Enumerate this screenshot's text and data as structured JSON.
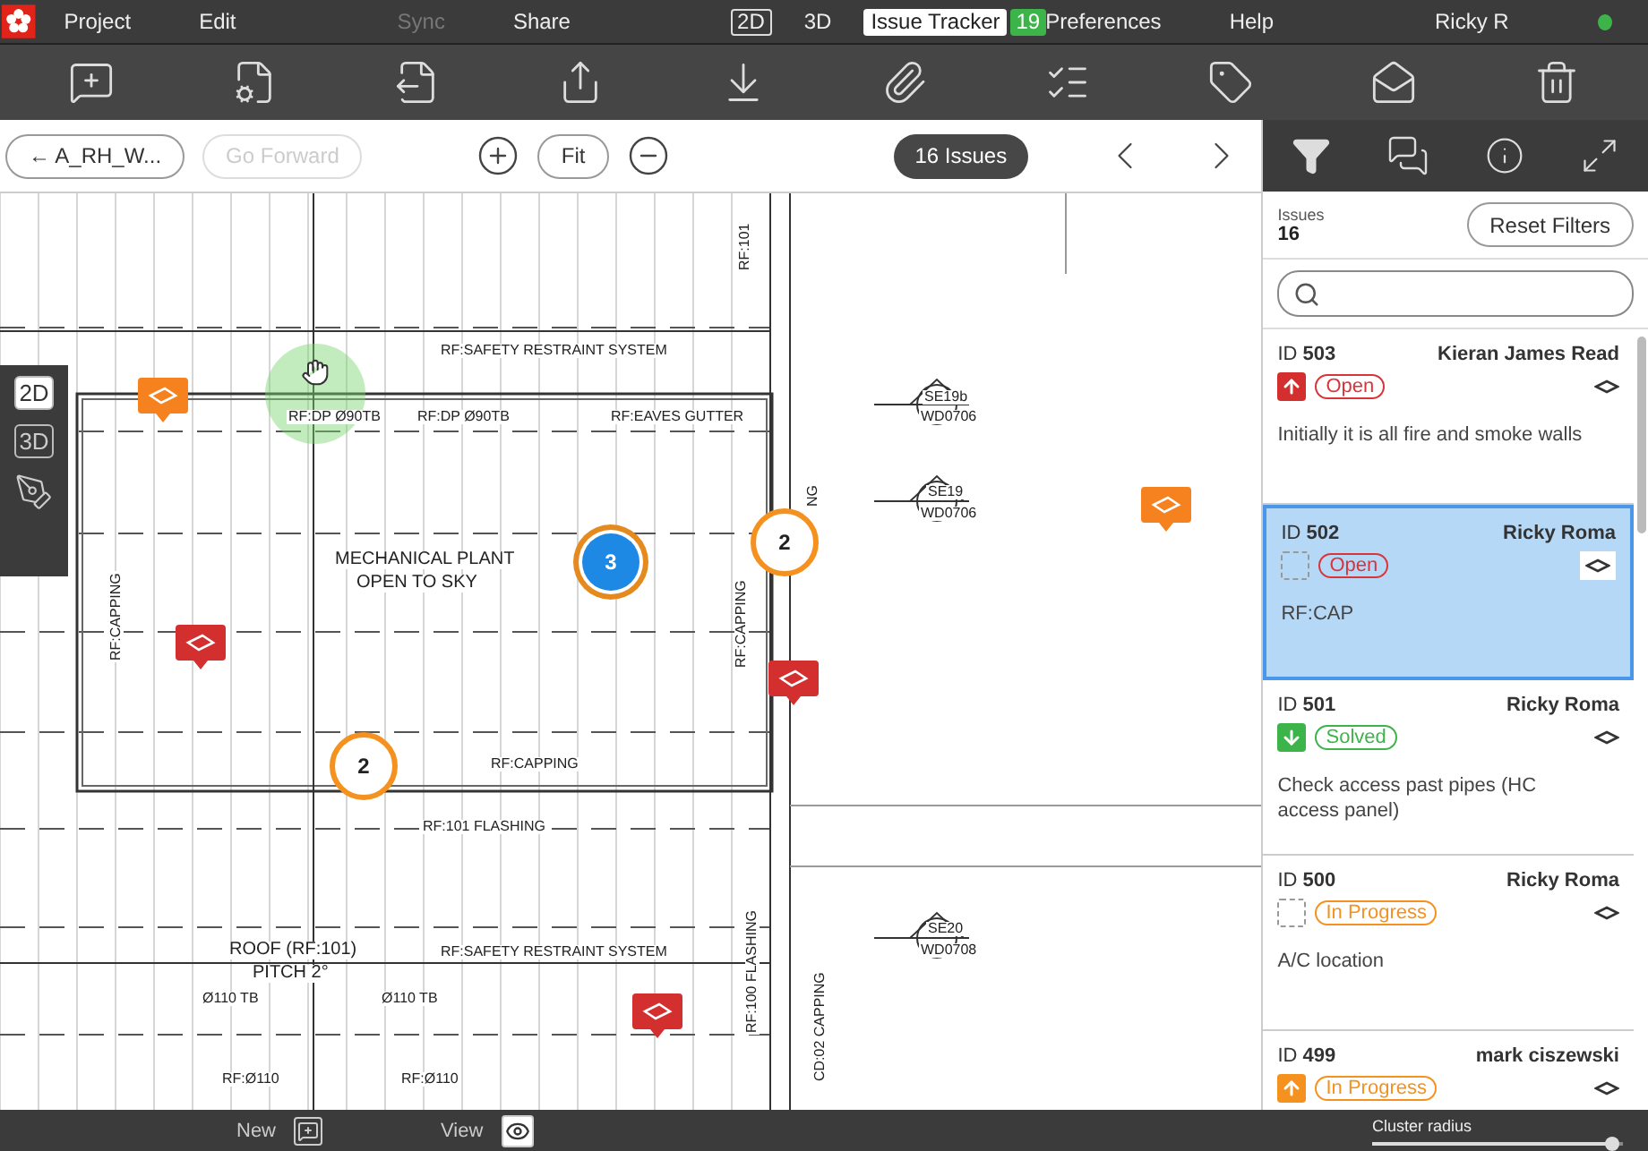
{
  "menu": {
    "items": [
      {
        "label": "Project",
        "disabled": false
      },
      {
        "label": "Edit",
        "disabled": false
      },
      {
        "label": "Sync",
        "disabled": true
      },
      {
        "label": "Share",
        "disabled": false
      }
    ],
    "modes": [
      {
        "label": "2D",
        "selected": true
      },
      {
        "label": "3D",
        "selected": false
      }
    ],
    "tracker": {
      "label": "Issue Tracker",
      "count": "19",
      "selected": true
    },
    "right_items": [
      {
        "label": "Preferences"
      },
      {
        "label": "Help"
      }
    ],
    "user": {
      "name": "Ricky R",
      "online": true
    }
  },
  "nav": {
    "back": "← A_RH_W...",
    "forward": {
      "label": "Go Forward",
      "disabled": true
    },
    "fit": "Fit",
    "issue_count": "16 Issues"
  },
  "view_switcher": [
    {
      "label": "2D",
      "selected": true
    },
    {
      "label": "3D",
      "selected": false
    }
  ],
  "drawing": {
    "labels": [
      {
        "text": "RF:101"
      },
      {
        "text": "RF:SAFETY RESTRAINT SYSTEM"
      },
      {
        "text": "RF:DP Ø90TB"
      },
      {
        "text": "RF:DP Ø90TB"
      },
      {
        "text": "RF:EAVES GUTTER"
      },
      {
        "text": "SE19b"
      },
      {
        "text": "WD0706"
      },
      {
        "text": "SE19"
      },
      {
        "text": "WD0706"
      },
      {
        "text": "NG"
      },
      {
        "text": "MECHANICAL PLANT"
      },
      {
        "text": "OPEN TO SKY"
      },
      {
        "text": "RF:CAPPING"
      },
      {
        "text": "RF:CAPPING"
      },
      {
        "text": "RF:CAPPING"
      },
      {
        "text": "RF:101 FLASHING"
      },
      {
        "text": "ROOF (RF:101)"
      },
      {
        "text": "RF:SAFETY RESTRAINT SYSTEM"
      },
      {
        "text": "PITCH 2°"
      },
      {
        "text": "Ø110 TB"
      },
      {
        "text": "Ø110 TB"
      },
      {
        "text": "RF:Ø110"
      },
      {
        "text": "RF:Ø110"
      },
      {
        "text": "SE20"
      },
      {
        "text": "WD0708"
      },
      {
        "text": "RF:100 FLASHING"
      },
      {
        "text": "CD:02 CAPPING"
      }
    ],
    "pins": [
      {
        "color": "#f5821f"
      },
      {
        "color": "#d32f2f"
      },
      {
        "color": "#d32f2f"
      },
      {
        "color": "#f5821f"
      },
      {
        "color": "#d32f2f"
      }
    ],
    "clusters": [
      {
        "count": "2",
        "kind": "outline"
      },
      {
        "count": "3",
        "kind": "mixed"
      },
      {
        "count": "2",
        "kind": "outline"
      }
    ]
  },
  "panel": {
    "issues_label": "Issues",
    "issues_count": "16",
    "reset": "Reset Filters",
    "issues": [
      {
        "id_label": "ID",
        "id": "503",
        "author": "Kieran James Read",
        "priority_icon": {
          "kind": "up",
          "color": "#d32f2f"
        },
        "status": {
          "label": "Open",
          "kind": "open"
        },
        "description": "Initially it is all fire and smoke walls",
        "selected": false
      },
      {
        "id_label": "ID",
        "id": "502",
        "author": "Ricky Roma",
        "priority_icon": {
          "kind": "empty"
        },
        "status": {
          "label": "Open",
          "kind": "open"
        },
        "description": "RF:CAP",
        "selected": true
      },
      {
        "id_label": "ID",
        "id": "501",
        "author": "Ricky Roma",
        "priority_icon": {
          "kind": "down",
          "color": "#3cb44a"
        },
        "status": {
          "label": "Solved",
          "kind": "solved"
        },
        "description": "Check access past pipes (HC access panel)",
        "selected": false
      },
      {
        "id_label": "ID",
        "id": "500",
        "author": "Ricky Roma",
        "priority_icon": {
          "kind": "empty"
        },
        "status": {
          "label": "In Progress",
          "kind": "progress"
        },
        "description": "A/C location",
        "selected": false
      },
      {
        "id_label": "ID",
        "id": "499",
        "author": "mark ciszewski",
        "priority_icon": {
          "kind": "up",
          "color": "#f5921f"
        },
        "status": {
          "label": "In Progress",
          "kind": "progress"
        },
        "selected": false
      }
    ]
  },
  "bottom": {
    "new": "New",
    "view": "View",
    "cluster_label": "Cluster radius",
    "level": 0.96
  }
}
